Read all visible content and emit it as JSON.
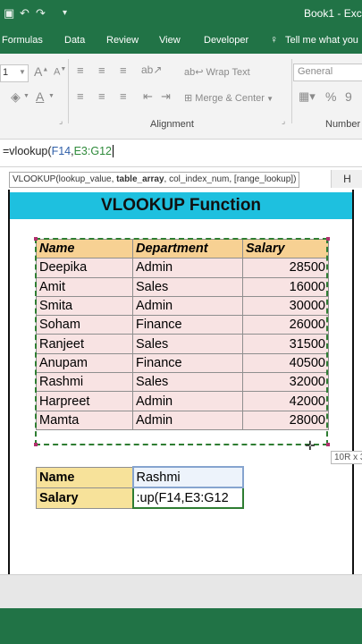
{
  "window": {
    "title": "Book1 - Exc"
  },
  "menu": {
    "items": [
      "Formulas",
      "Data",
      "Review",
      "View",
      "Developer",
      "Tell me what you"
    ]
  },
  "ribbon": {
    "font_size": "1",
    "wrap_text": "Wrap Text",
    "merge_center": "Merge & Center",
    "number_format": "General",
    "percent": "%",
    "comma": "9",
    "alignment_group": "Alignment",
    "number_group": "Number"
  },
  "formula_bar": {
    "prefix": "=vlookup(",
    "arg1": "F14",
    "sep": ",",
    "arg2": "E3:G12"
  },
  "tooltip": {
    "start": "VLOOKUP(lookup_value, ",
    "bold": "table_array",
    "end": ", col_index_num, [range_lookup])"
  },
  "column_header": "H",
  "sheet": {
    "banner": "VLOOKUP Function",
    "headers": [
      "Name",
      "Department",
      "Salary"
    ],
    "rows": [
      [
        "Deepika",
        "Admin",
        "28500"
      ],
      [
        "Amit",
        "Sales",
        "16000"
      ],
      [
        "Smita",
        "Admin",
        "30000"
      ],
      [
        "Soham",
        "Finance",
        "26000"
      ],
      [
        "Ranjeet",
        "Sales",
        "31500"
      ],
      [
        "Anupam",
        "Finance",
        "40500"
      ],
      [
        "Rashmi",
        "Sales",
        "32000"
      ],
      [
        "Harpreet",
        "Admin",
        "42000"
      ],
      [
        "Mamta",
        "Admin",
        "28000"
      ]
    ],
    "lookup": {
      "name_label": "Name",
      "name_value": "Rashmi",
      "salary_label": "Salary",
      "salary_value": ":up(F14,E3:G12"
    },
    "selection_size": "10R x 3"
  },
  "colors": {
    "excel_green": "#217346",
    "banner": "#1ec0df",
    "header_fill": "#f7d193",
    "row_fill": "#f8e3e3",
    "label_fill": "#f7e29a"
  }
}
